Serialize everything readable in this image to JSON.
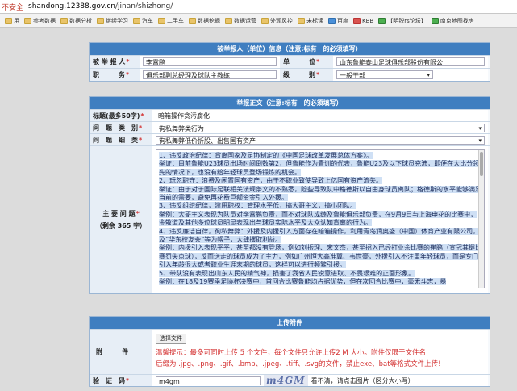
{
  "browser": {
    "security_text": "不安全",
    "url_host": "shandong.12388.gov.cn",
    "url_path": "/jinan/shizhong/",
    "bookmarks": [
      "用",
      "参考数据",
      "数据分析",
      "继续学习",
      "汽车",
      "二手车",
      "数据挖掘",
      "数据运营",
      "外观风控",
      "未标读",
      "百度",
      "KBB",
      "【明锐rs论坛】",
      "南京地图找房"
    ]
  },
  "reported_section": {
    "title": "被举报人（单位）信息（注意:标有　的必须填写）",
    "name_label": "被 举 报 人",
    "name_value": "李霄鹏",
    "unit_label": "单　　　位",
    "unit_value": "山东鲁能泰山足球俱乐部股份有限公",
    "post_label": "职　　　务",
    "post_value": "俱乐部副总经理及球队主教练",
    "level_label": "级　　　别",
    "level_value": "一般干部"
  },
  "content_section": {
    "title": "举报正文（注意:标有　的必须填写）",
    "subject_label": "标题(最多50字)",
    "subject_value": "暗箱操作贪污腐化",
    "category_label": "问　题　类　别",
    "category_value": "徇私舞弊类行为",
    "detail_label": "问　题　细　类",
    "detail_value": "徇私舞弊低价折股、出售国有资产",
    "main_label": "主 要 问 题",
    "remaining_label": "（剩余 365 字）",
    "main_lines": [
      "1、违反政治纪律：背离国家及足协制定的《中国足球改革发展总体方案》。",
      "举证：目前鲁能U23球员出场时间倒数第2，但鲁能作为青训的代表，鲁能U23及以下球员充沛，即便在大比分领先的情况下，也没有给年轻球员登场锻炼的机会。",
      "2、玩忽职守：浪费及闲置国有资产，由于不职业致使导致上亿国有资产流失。",
      "举证：由于对于国际足联相关法规条文的不熟悉，险些导致队中格德斯以自由身球员离队；格德斯的水平能够满足当前的需要，避免再花费巨额资金引入外援。",
      "3、违反组织纪律，滥用职权：管理水平低，搞大哥主义，搞小团队。",
      "举例：大哥主义表现为队员对李霄鹏负责，而不对球队成绩及鲁能俱乐部负责，在9月9日与上海申花的比赛中，金敬道及其他多位球员明显表现出与球员实际水平及大众认知背离的行为。",
      "4、违反廉洁自律，徇私舞弊：外援及内援引入方面存在暗箱操作，利用青岛润奥盛（中国）体育产业有限公司，及“华东校友会”等为幌子，大肆攫取利益。",
      "举例：内援引入表现平平，甚至都没有登场，例如刘振理、宋文杰，甚至招入已经打业余比赛的崔鹏（宣冠其键比赛罚失点球），反而送走的球员成为了主力，例如广州恒大高准翼、韦世豪，外援引入不注重年轻球员，而是专门引入年龄很大或者职业生涯末期的球员，这样可以进行频繁引援。",
      "5、带队没有表现出山东人民的精气神，损害了我省人民锐意进取、不畏艰难的正面形象。",
      "举例：在18及19赛季足协杯决赛中，首回合比赛鲁能均占据优势，但在次回合比赛中，毫无斗志，暴"
    ]
  },
  "upload_section": {
    "title": "上传附件",
    "attach_label": "附　　　件",
    "choose_button": "选择文件",
    "hint_line1": "温馨提示：最多可同时上传 5 个文件，每个文件只允许上传2 M 大小。附件仅限于文件名",
    "hint_line2": "后缀为 .jpg、.png、.gif、.bmp、.jpeg、.tiff、.svg的文件，禁止exe、bat等格式文件上传!",
    "captcha_label": "验　证　码",
    "captcha_value": "m4gm",
    "captcha_image_text": "m4GM",
    "captcha_hint": "看不清，请点击图片（区分大小写）"
  },
  "required_mark": "*",
  "colors": {
    "header": "#3f7ec0",
    "required": "#d32f2f",
    "selection": "#cfe0f5"
  }
}
